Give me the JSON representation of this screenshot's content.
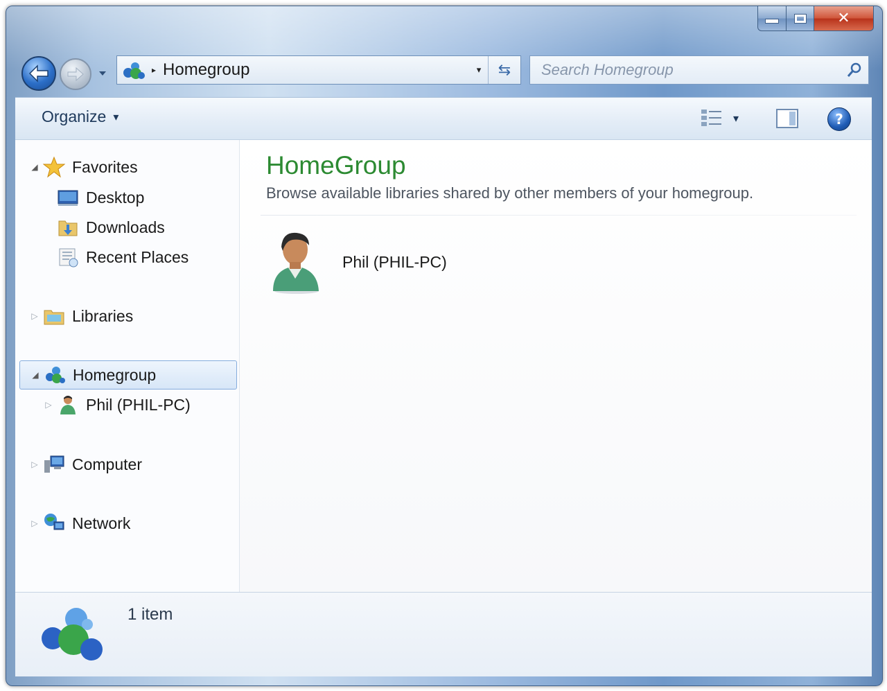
{
  "window": {
    "controls": {
      "minimize": "minimize-icon",
      "maximize": "maximize-icon",
      "close": "✕"
    }
  },
  "navigation": {
    "back_icon": "back-arrow-icon",
    "forward_icon": "forward-arrow-icon",
    "recent_dropdown_icon": "chevron-down-icon"
  },
  "address_bar": {
    "icon": "homegroup-icon",
    "separator": "▸",
    "path": "Homegroup",
    "dropdown_icon": "▾",
    "refresh_icon": "⇆"
  },
  "search": {
    "placeholder": "Search Homegroup",
    "icon": "search-icon"
  },
  "toolbar": {
    "organize_label": "Organize",
    "organize_arrow": "▾",
    "view_arrow": "▾",
    "help_label": "?"
  },
  "sidebar": {
    "favorites": {
      "label": "Favorites",
      "expanded": true,
      "items": [
        {
          "label": "Desktop",
          "icon": "desktop-icon"
        },
        {
          "label": "Downloads",
          "icon": "downloads-folder-icon"
        },
        {
          "label": "Recent Places",
          "icon": "recent-places-icon"
        }
      ]
    },
    "libraries": {
      "label": "Libraries",
      "expanded": false
    },
    "homegroup": {
      "label": "Homegroup",
      "expanded": true,
      "selected": true,
      "children": [
        {
          "label": "Phil (PHIL-PC)",
          "icon": "user-icon"
        }
      ]
    },
    "computer": {
      "label": "Computer",
      "expanded": false
    },
    "network": {
      "label": "Network",
      "expanded": false
    }
  },
  "main": {
    "title": "HomeGroup",
    "subtitle": "Browse available libraries shared by other members of your homegroup.",
    "members": [
      {
        "name": "Phil (PHIL-PC)",
        "icon": "user-avatar-icon"
      }
    ]
  },
  "details_pane": {
    "icon": "homegroup-large-icon",
    "count_text": "1 item"
  },
  "colors": {
    "title_green": "#2c8a32",
    "selection_border": "#84acdd",
    "chrome_blue": "#6f98c9"
  }
}
